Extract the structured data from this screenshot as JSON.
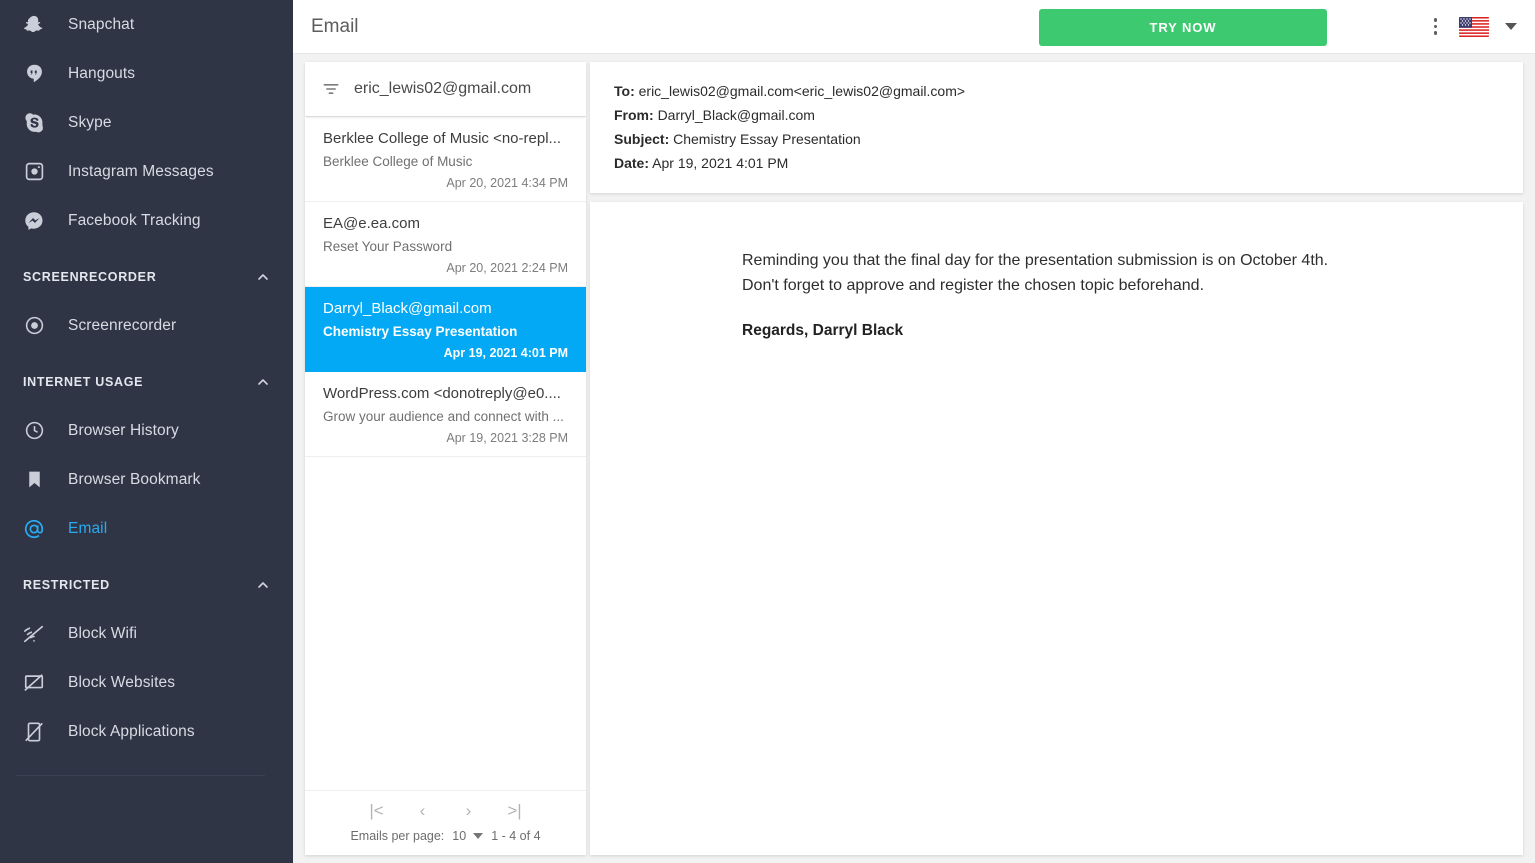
{
  "sidebar": {
    "top_items": [
      {
        "label": "Snapchat",
        "icon": "snapchat-icon"
      },
      {
        "label": "Hangouts",
        "icon": "hangouts-icon"
      },
      {
        "label": "Skype",
        "icon": "skype-icon"
      },
      {
        "label": "Instagram Messages",
        "icon": "instagram-icon"
      },
      {
        "label": "Facebook Tracking",
        "icon": "facebook-messenger-icon"
      }
    ],
    "sections": [
      {
        "title": "SCREENRECORDER",
        "items": [
          {
            "label": "Screenrecorder",
            "icon": "record-circle-icon"
          }
        ]
      },
      {
        "title": "INTERNET USAGE",
        "items": [
          {
            "label": "Browser History",
            "icon": "clock-icon"
          },
          {
            "label": "Browser Bookmark",
            "icon": "bookmark-icon"
          },
          {
            "label": "Email",
            "icon": "at-sign-icon",
            "active": true
          }
        ]
      },
      {
        "title": "RESTRICTED",
        "items": [
          {
            "label": "Block Wifi",
            "icon": "wifi-off-icon"
          },
          {
            "label": "Block Websites",
            "icon": "desktop-off-icon"
          },
          {
            "label": "Block Applications",
            "icon": "phone-off-icon"
          }
        ]
      }
    ]
  },
  "topbar": {
    "title": "Email",
    "try_now_label": "TRY NOW",
    "kebab_icon": "more-vertical-icon",
    "flag_icon": "us-flag-icon",
    "caret_icon": "chevron-down-icon"
  },
  "list": {
    "filter_icon": "filter-list-icon",
    "account": "eric_lewis02@gmail.com",
    "emails": [
      {
        "sender": "Berklee College of Music <no-repl...",
        "subject": "Berklee College of Music",
        "date": "Apr 20, 2021 4:34 PM",
        "selected": false
      },
      {
        "sender": "EA@e.ea.com",
        "subject": "Reset Your Password",
        "date": "Apr 20, 2021 2:24 PM",
        "selected": false
      },
      {
        "sender": "Darryl_Black@gmail.com",
        "subject": "Chemistry Essay Presentation",
        "date": "Apr 19, 2021 4:01 PM",
        "selected": true
      },
      {
        "sender": "WordPress.com <donotreply@e0....",
        "subject": "Grow your audience and connect with ...",
        "date": "Apr 19, 2021 3:28 PM",
        "selected": false
      }
    ],
    "paginator": {
      "first_label": "|<",
      "prev_label": "‹",
      "next_label": "›",
      "last_label": ">|",
      "per_page_label": "Emails per page:",
      "per_page_value": "10",
      "range_label": "1 - 4 of 4"
    }
  },
  "reader": {
    "to_label": "To:",
    "to_value": "eric_lewis02@gmail.com<eric_lewis02@gmail.com>",
    "from_label": "From:",
    "from_value": "Darryl_Black@gmail.com",
    "subject_label": "Subject:",
    "subject_value": "Chemistry Essay Presentation",
    "date_label": "Date:",
    "date_value": "Apr 19, 2021 4:01 PM",
    "body": "Reminding you that the final day for the presentation submission is on October 4th. Don't forget to approve and register the chosen topic beforehand.",
    "signature": "Regards, Darryl Black"
  },
  "colors": {
    "sidebar_bg": "#2f3545",
    "accent_blue": "#03a9f4",
    "cta_green": "#3cc96f",
    "page_bg": "#f2f2f2"
  }
}
